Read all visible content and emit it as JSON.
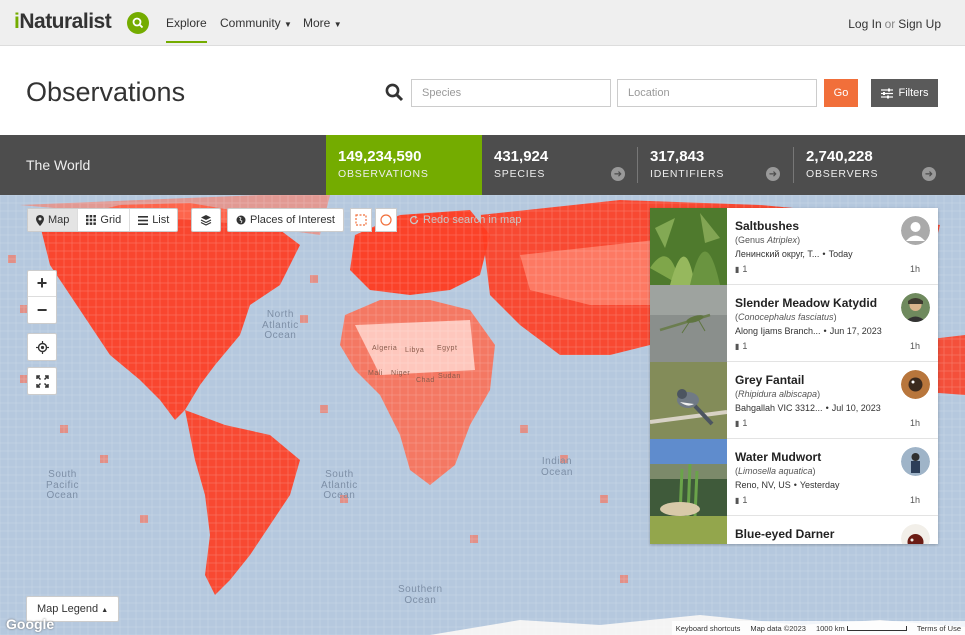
{
  "nav": {
    "logo_prefix": "i",
    "logo_rest": "Naturalist",
    "explore": "Explore",
    "community": "Community",
    "more": "More",
    "login": "Log In",
    "or": "or",
    "signup": "Sign Up"
  },
  "header": {
    "title": "Observations",
    "species_placeholder": "Species",
    "location_placeholder": "Location",
    "go_label": "Go",
    "filters_label": "Filters"
  },
  "stats": {
    "place": "The World",
    "observations": {
      "value": "149,234,590",
      "label": "OBSERVATIONS"
    },
    "species": {
      "value": "431,924",
      "label": "SPECIES"
    },
    "identifiers": {
      "value": "317,843",
      "label": "IDENTIFIERS"
    },
    "observers": {
      "value": "2,740,228",
      "label": "OBSERVERS"
    }
  },
  "map": {
    "view_map": "Map",
    "view_grid": "Grid",
    "view_list": "List",
    "places_of_interest": "Places of Interest",
    "redo_search": "Redo search in map",
    "legend_label": "Map Legend",
    "google": "Google",
    "attribution": {
      "shortcuts": "Keyboard shortcuts",
      "map_data": "Map data ©2023",
      "scale": "1000 km",
      "terms": "Terms of Use"
    },
    "labels": {
      "atlantic": "North\nAtlantic\nOcean",
      "south_atlantic": "South\nAtlantic\nOcean",
      "south_pacific": "South\nPacific\nOcean",
      "indian": "Indian\nOcean",
      "southern": "Southern\nOcean",
      "algeria": "Algeria",
      "libya": "Libya",
      "egypt": "Egypt",
      "mali": "Mali",
      "niger": "Niger",
      "chad": "Chad",
      "sudan": "Sudan"
    }
  },
  "observations": [
    {
      "name": "Saltbushes",
      "sci_prefix": "Genus",
      "sci": "Atriplex",
      "place": "Ленинский округ, Т...",
      "date": "Today",
      "ids": "1",
      "time": "1h"
    },
    {
      "name": "Slender Meadow Katydid",
      "sci_prefix": "",
      "sci": "Conocephalus fasciatus",
      "place": "Along Ijams Branch...",
      "date": "Jun 17, 2023",
      "ids": "1",
      "time": "1h"
    },
    {
      "name": "Grey Fantail",
      "sci_prefix": "",
      "sci": "Rhipidura albiscapa",
      "place": "Bahgallah VIC 3312...",
      "date": "Jul 10, 2023",
      "ids": "1",
      "time": "1h"
    },
    {
      "name": "Water Mudwort",
      "sci_prefix": "",
      "sci": "Limosella aquatica",
      "place": "Reno, NV, US",
      "date": "Yesterday",
      "ids": "1",
      "time": "1h"
    },
    {
      "name": "Blue-eyed Darner",
      "sci_prefix": "",
      "sci": "",
      "place": "",
      "date": "",
      "ids": "",
      "time": ""
    }
  ],
  "colors": {
    "brand_green": "#74ac00",
    "go_orange": "#f16f3a",
    "heat_red": "#ff3b1f",
    "ocean": "#b5c8de"
  }
}
